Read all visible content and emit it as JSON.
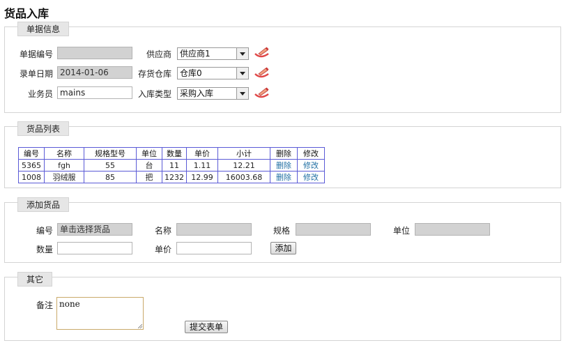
{
  "page": {
    "title": "货品入库"
  },
  "doc_info": {
    "legend": "单据信息",
    "doc_no_label": "单据编号",
    "doc_no_value": "",
    "date_label": "录单日期",
    "date_value": "2014-01-06",
    "clerk_label": "业务员",
    "clerk_value": "mains",
    "supplier_label": "供应商",
    "supplier_value": "供应商1",
    "warehouse_label": "存货仓库",
    "warehouse_value": "仓库0",
    "type_label": "入库类型",
    "type_value": "采购入库",
    "edit_icon": "edit-pencil-icon"
  },
  "goods_list": {
    "legend": "货品列表",
    "headers": [
      "编号",
      "名称",
      "规格型号",
      "单位",
      "数量",
      "单价",
      "小计",
      "删除",
      "修改"
    ],
    "rows": [
      [
        "5365",
        "fgh",
        "55",
        "台",
        "11",
        "1.11",
        "12.21",
        "删除",
        "修改"
      ],
      [
        "1008",
        "羽绒服",
        "85",
        "把",
        "1232",
        "12.99",
        "16003.68",
        "删除",
        "修改"
      ]
    ]
  },
  "add_goods": {
    "legend": "添加货品",
    "code_label": "编号",
    "code_value": "单击选择货品",
    "name_label": "名称",
    "spec_label": "规格",
    "unit_label": "单位",
    "qty_label": "数量",
    "price_label": "单价",
    "add_button": "添加"
  },
  "other": {
    "legend": "其它",
    "remark_label": "备注",
    "remark_value": "none",
    "submit_button": "提交表单"
  }
}
